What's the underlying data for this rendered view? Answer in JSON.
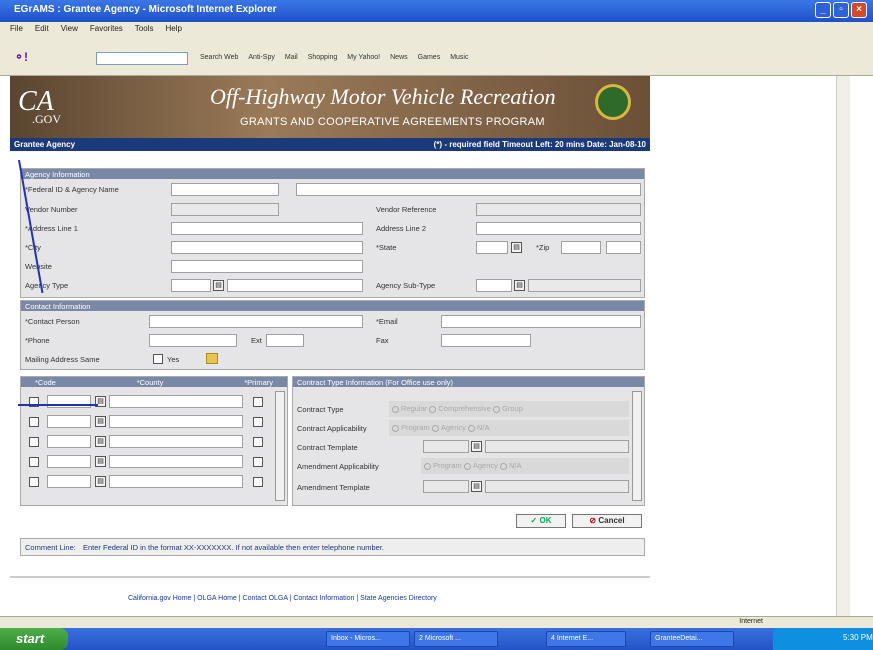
{
  "window": {
    "title": "EGrAMS : Grantee Agency - Microsoft Internet Explorer"
  },
  "menu": [
    "File",
    "Edit",
    "View",
    "Favorites",
    "Tools",
    "Help"
  ],
  "toolbar": {
    "items": [
      "Search Web",
      "Anti-Spy",
      "Mail",
      "Shopping",
      "My Yahoo!",
      "News",
      "Games",
      "Music"
    ]
  },
  "banner": {
    "logo": "CA",
    "logo_sub": ".GOV",
    "title": "Off-Highway Motor Vehicle Recreation",
    "subtitle": "GRANTS AND COOPERATIVE AGREEMENTS PROGRAM"
  },
  "nav": {
    "left": "Grantee Agency",
    "right": "(*) - required field   Timeout Left: 20 mins   Date: Jan-08-10"
  },
  "agency": {
    "header": "Agency Information",
    "federal": "*Federal ID & Agency Name",
    "vendor": "Vendor Number",
    "vendor_ref": "Vendor Reference",
    "addr1": "*Address Line 1",
    "addr2": "Address Line 2",
    "city": "*City",
    "state": "*State",
    "zip": "*Zip",
    "website": "Website",
    "type": "Agency Type",
    "subtype": "Agency Sub-Type"
  },
  "contact": {
    "header": "Contact Information",
    "person": "*Contact Person",
    "email": "*Email",
    "phone": "*Phone",
    "ext": "Ext",
    "fax": "Fax",
    "mailing": "Mailing Address Same",
    "yes": "Yes"
  },
  "county": {
    "code": "*Code",
    "county": "*County",
    "primary": "*Primary"
  },
  "contract": {
    "header": "Contract Type Information (For Office use only)",
    "type": "Contract Type",
    "applicability": "Contract Applicability",
    "template": "Contract Template",
    "amend_app": "Amendment Applicability",
    "amend_tpl": "Amendment Template",
    "opts_type": [
      "Regular",
      "Comprehensive",
      "Group"
    ],
    "opts_app": [
      "Program",
      "Agency",
      "N/A"
    ]
  },
  "buttons": {
    "ok": "OK",
    "cancel": "Cancel"
  },
  "comment": {
    "label": "Comment Line:",
    "text": "Enter Federal ID in the format XX-XXXXXXX. If not available then enter telephone number."
  },
  "footer": "California.gov Home | OLGA Home | Contact OLGA | Contact Information | State Agencies Directory",
  "status": {
    "zone": "Internet"
  },
  "taskbar": {
    "start": "start",
    "items": [
      "Inbox - Micros...",
      "2 Microsoft ...",
      "4 Internet E...",
      "GranteeDetai..."
    ],
    "clock": "5:30 PM"
  }
}
